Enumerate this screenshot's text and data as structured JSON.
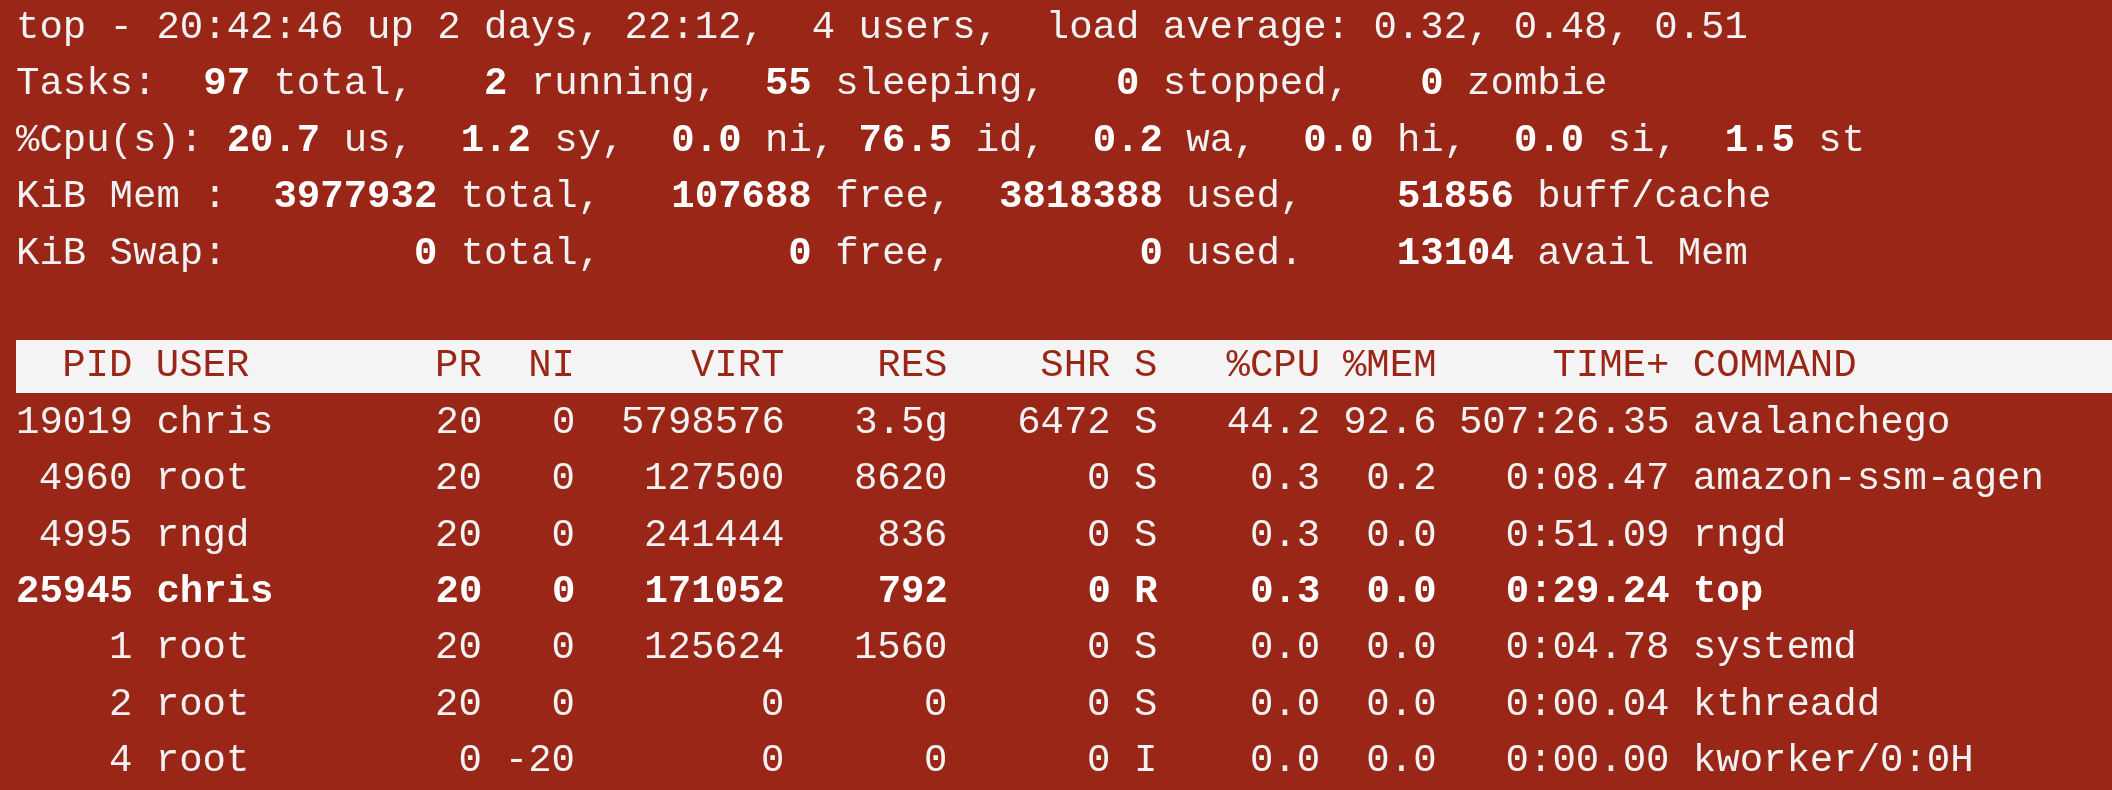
{
  "summary_lines": [
    "top - 20:42:46 up 2 days, 22:12,  4 users,  load average: 0.32, 0.48, 0.51",
    "Tasks:  **97** total,   **2** running,  **55** sleeping,   **0** stopped,   **0** zombie",
    "%Cpu(s): **20.7** us,  **1.2** sy,  **0.0** ni, **76.5** id,  **0.2** wa,  **0.0** hi,  **0.0** si,  **1.5** st",
    "KiB Mem :  **3977932** total,   **107688** free,  **3818388** used,    **51856** buff/cache",
    "KiB Swap:        **0** total,        **0** free,        **0** used.    **13104** avail Mem"
  ],
  "table": {
    "columns": [
      "PID",
      "USER",
      "PR",
      "NI",
      "VIRT",
      "RES",
      "SHR",
      "S",
      "%CPU",
      "%MEM",
      "TIME+",
      "COMMAND"
    ],
    "rows": [
      {
        "highlighted": false,
        "cells": [
          "19019",
          "chris",
          "20",
          "0",
          "5798576",
          "3.5g",
          "6472",
          "S",
          "44.2",
          "92.6",
          "507:26.35",
          "avalanchego"
        ]
      },
      {
        "highlighted": false,
        "cells": [
          "4960",
          "root",
          "20",
          "0",
          "127500",
          "8620",
          "0",
          "S",
          "0.3",
          "0.2",
          "0:08.47",
          "amazon-ssm-agen"
        ]
      },
      {
        "highlighted": false,
        "cells": [
          "4995",
          "rngd",
          "20",
          "0",
          "241444",
          "836",
          "0",
          "S",
          "0.3",
          "0.0",
          "0:51.09",
          "rngd"
        ]
      },
      {
        "highlighted": true,
        "cells": [
          "25945",
          "chris",
          "20",
          "0",
          "171052",
          "792",
          "0",
          "R",
          "0.3",
          "0.0",
          "0:29.24",
          "top"
        ]
      },
      {
        "highlighted": false,
        "cells": [
          "1",
          "root",
          "20",
          "0",
          "125624",
          "1560",
          "0",
          "S",
          "0.0",
          "0.0",
          "0:04.78",
          "systemd"
        ]
      },
      {
        "highlighted": false,
        "cells": [
          "2",
          "root",
          "20",
          "0",
          "0",
          "0",
          "0",
          "S",
          "0.0",
          "0.0",
          "0:00.04",
          "kthreadd"
        ]
      },
      {
        "highlighted": false,
        "cells": [
          "4",
          "root",
          "0",
          "-20",
          "0",
          "0",
          "0",
          "I",
          "0.0",
          "0.0",
          "0:00.00",
          "kworker/0:0H"
        ]
      }
    ]
  }
}
